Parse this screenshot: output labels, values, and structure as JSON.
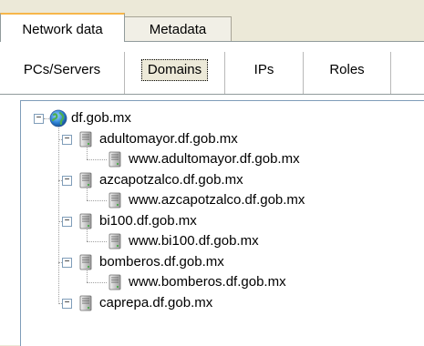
{
  "outer_tabs": [
    {
      "label": "Network data"
    },
    {
      "label": "Metadata"
    }
  ],
  "inner_tabs": [
    {
      "label": "PCs/Servers"
    },
    {
      "label": "Domains"
    },
    {
      "label": "IPs"
    },
    {
      "label": "Roles"
    }
  ],
  "tree": {
    "root": {
      "label": "df.gob.mx",
      "icon": "globe-icon",
      "expanded": true
    },
    "children": [
      {
        "label": "adultomayor.df.gob.mx",
        "icon": "server-icon",
        "expanded": true,
        "child": "www.adultomayor.df.gob.mx"
      },
      {
        "label": "azcapotzalco.df.gob.mx",
        "icon": "server-icon",
        "expanded": true,
        "child": "www.azcapotzalco.df.gob.mx"
      },
      {
        "label": "bi100.df.gob.mx",
        "icon": "server-icon",
        "expanded": true,
        "child": "www.bi100.df.gob.mx"
      },
      {
        "label": "bomberos.df.gob.mx",
        "icon": "server-icon",
        "expanded": true,
        "child": "www.bomberos.df.gob.mx"
      },
      {
        "label": "caprepa.df.gob.mx",
        "icon": "server-icon",
        "expanded": true
      }
    ]
  },
  "expander_symbol": "−"
}
